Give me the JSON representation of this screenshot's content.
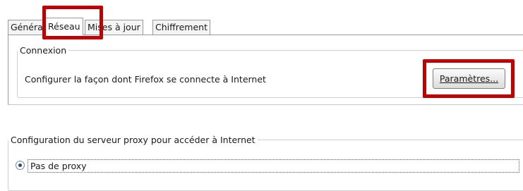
{
  "tabs": [
    {
      "label": "Général"
    },
    {
      "label": "Réseau",
      "active": true
    },
    {
      "label": "Mises à jour"
    },
    {
      "label": "Chiffrement"
    }
  ],
  "connection": {
    "legend": "Connexion",
    "description": "Configurer la façon dont Firefox se connecte à Internet",
    "settings_button": "Paramètres..."
  },
  "proxy": {
    "legend": "Configuration du serveur proxy pour accéder à Internet",
    "option_label": "Pas de proxy",
    "option_selected": true
  },
  "colors": {
    "highlight": "#c00000"
  }
}
